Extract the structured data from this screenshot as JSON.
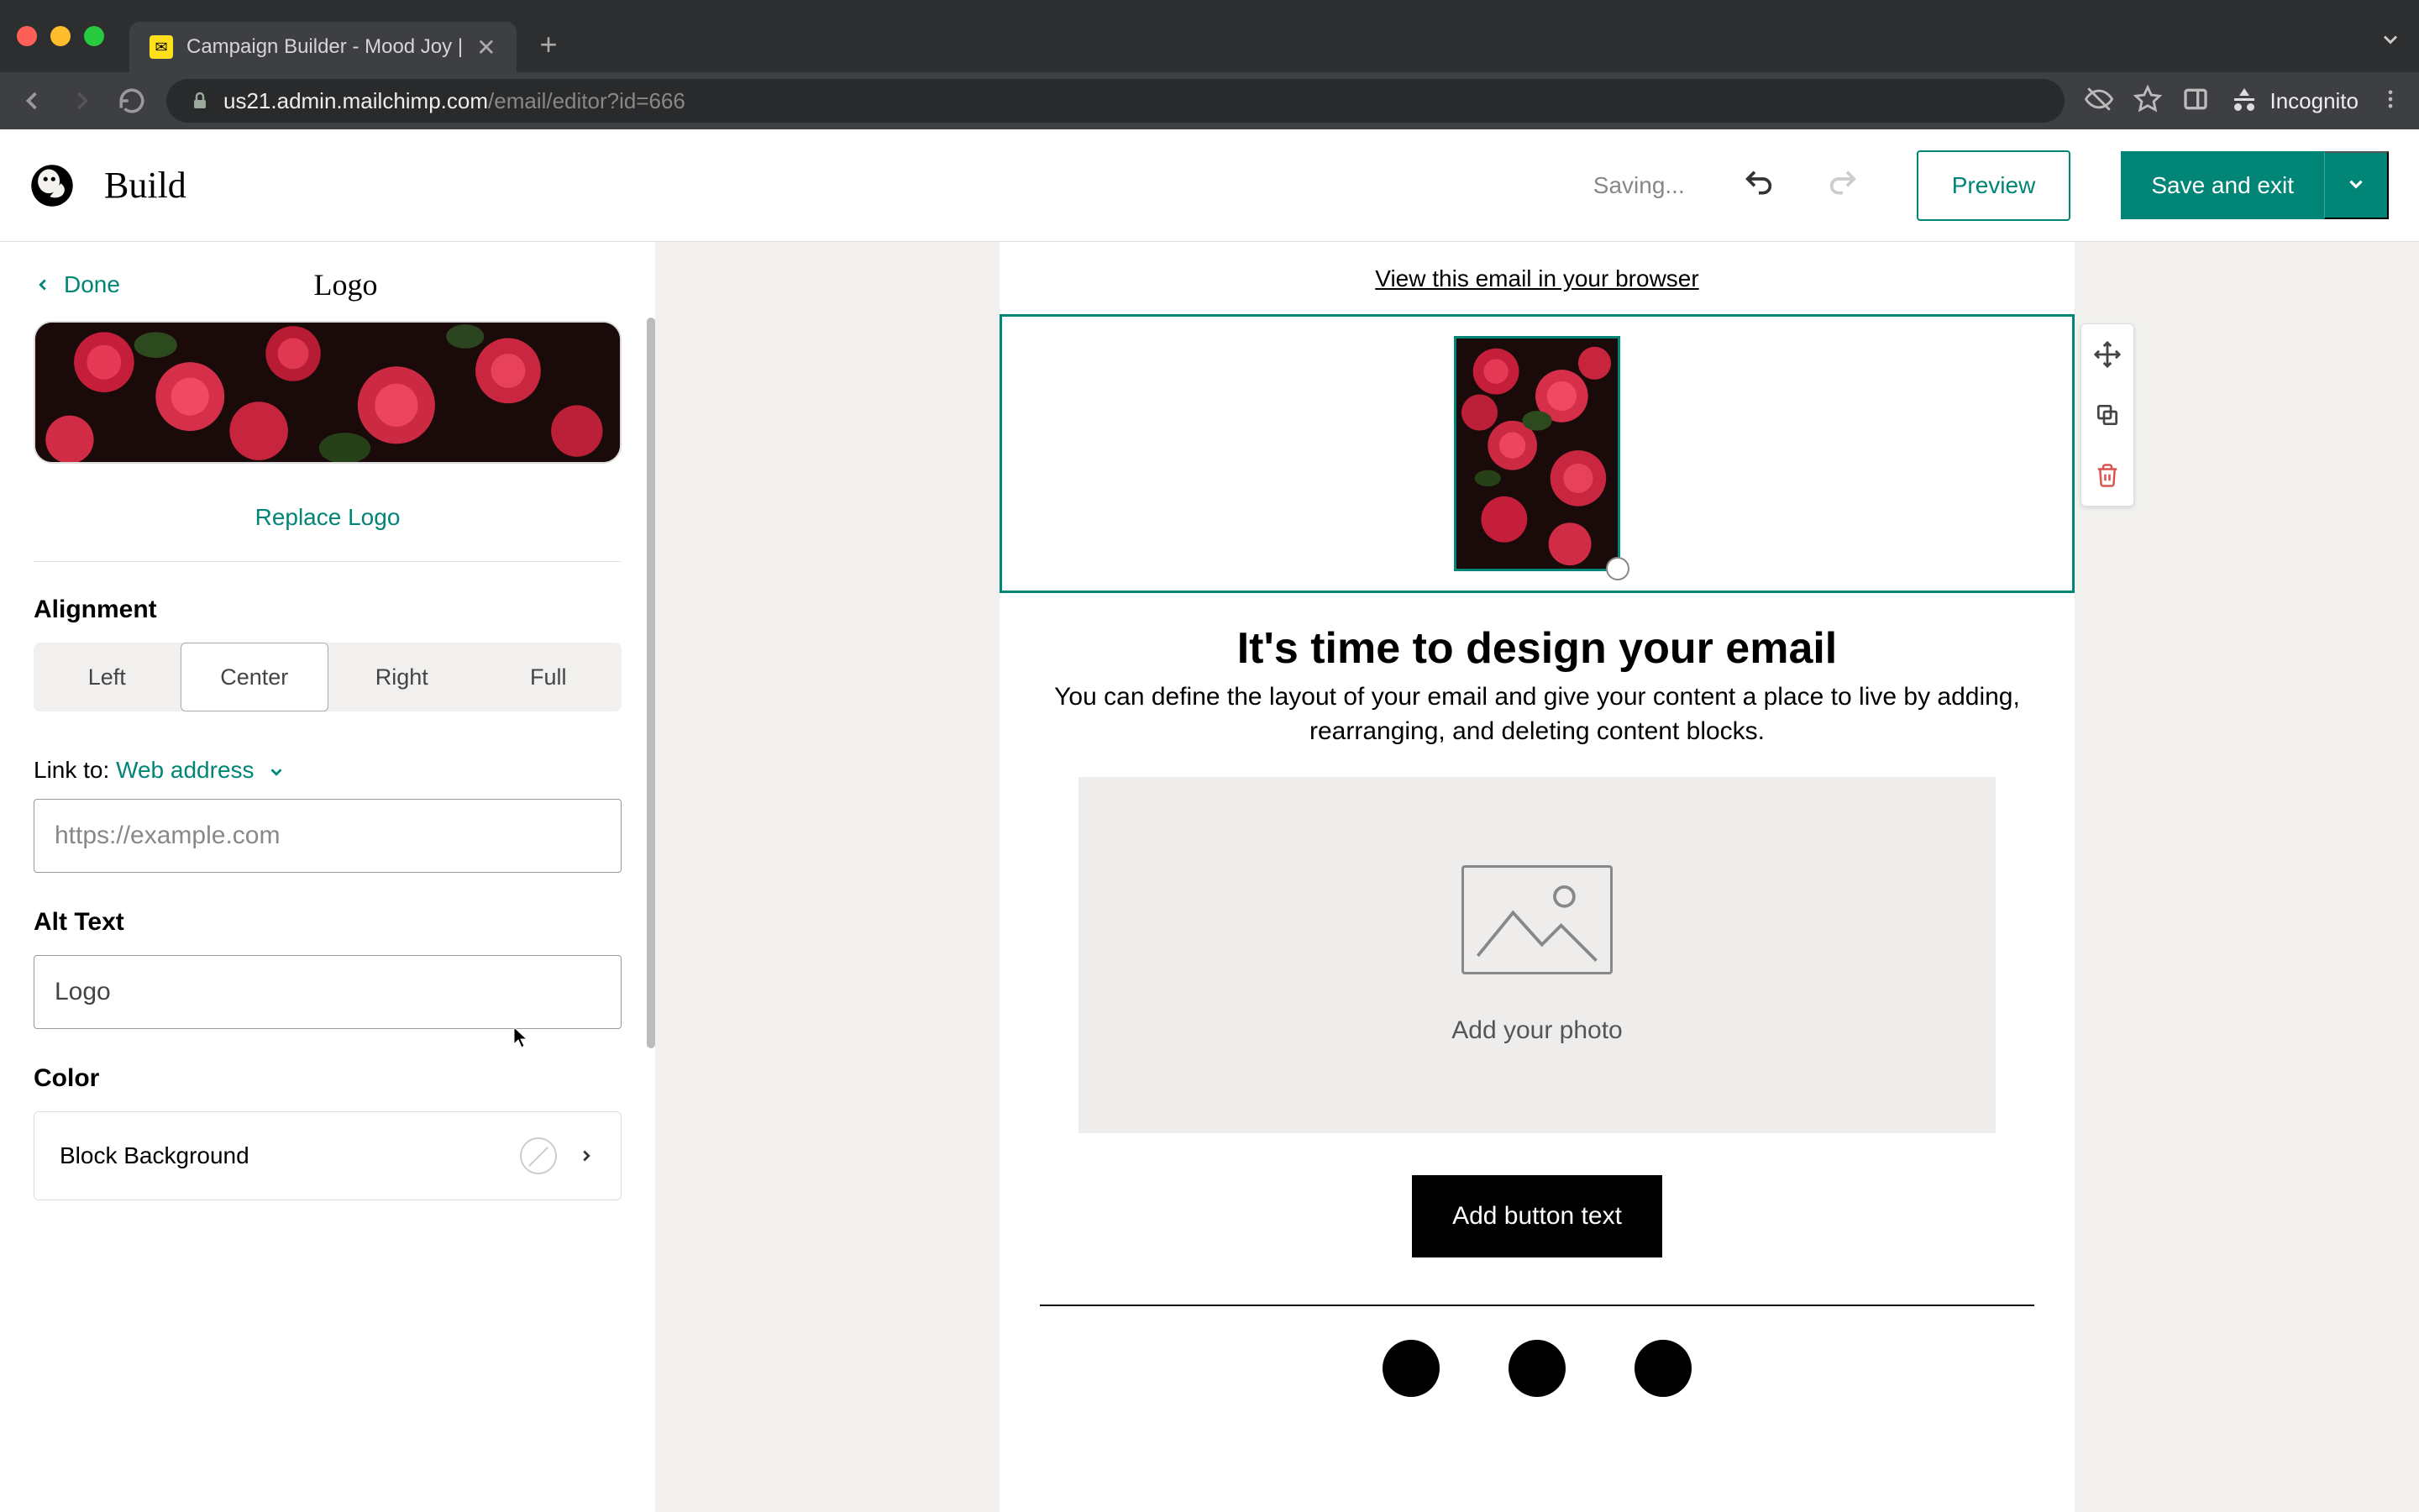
{
  "browser": {
    "tab_title": "Campaign Builder - Mood Joy |",
    "url_domain": "us21.admin.mailchimp.com",
    "url_path": "/email/editor?id=666",
    "incognito_label": "Incognito"
  },
  "header": {
    "title": "Build",
    "status": "Saving...",
    "preview_label": "Preview",
    "save_label": "Save and exit"
  },
  "sidebar": {
    "done_label": "Done",
    "panel_title": "Logo",
    "replace_label": "Replace Logo",
    "alignment_label": "Alignment",
    "alignment_options": {
      "left": "Left",
      "center": "Center",
      "right": "Right",
      "full": "Full"
    },
    "alignment_selected": "Center",
    "link_label_prefix": "Link to: ",
    "link_type": "Web address",
    "link_placeholder": "https://example.com",
    "alt_label": "Alt Text",
    "alt_value": "Logo",
    "color_label": "Color",
    "color_row_label": "Block Background"
  },
  "email": {
    "view_browser": "View this email in your browser",
    "heading": "It's time to design your email",
    "body": "You can define the layout of your email and give your content a place to live by adding, rearranging, and deleting content blocks.",
    "photo_placeholder": "Add your photo",
    "button_label": "Add button text"
  },
  "colors": {
    "teal": "#008577"
  }
}
